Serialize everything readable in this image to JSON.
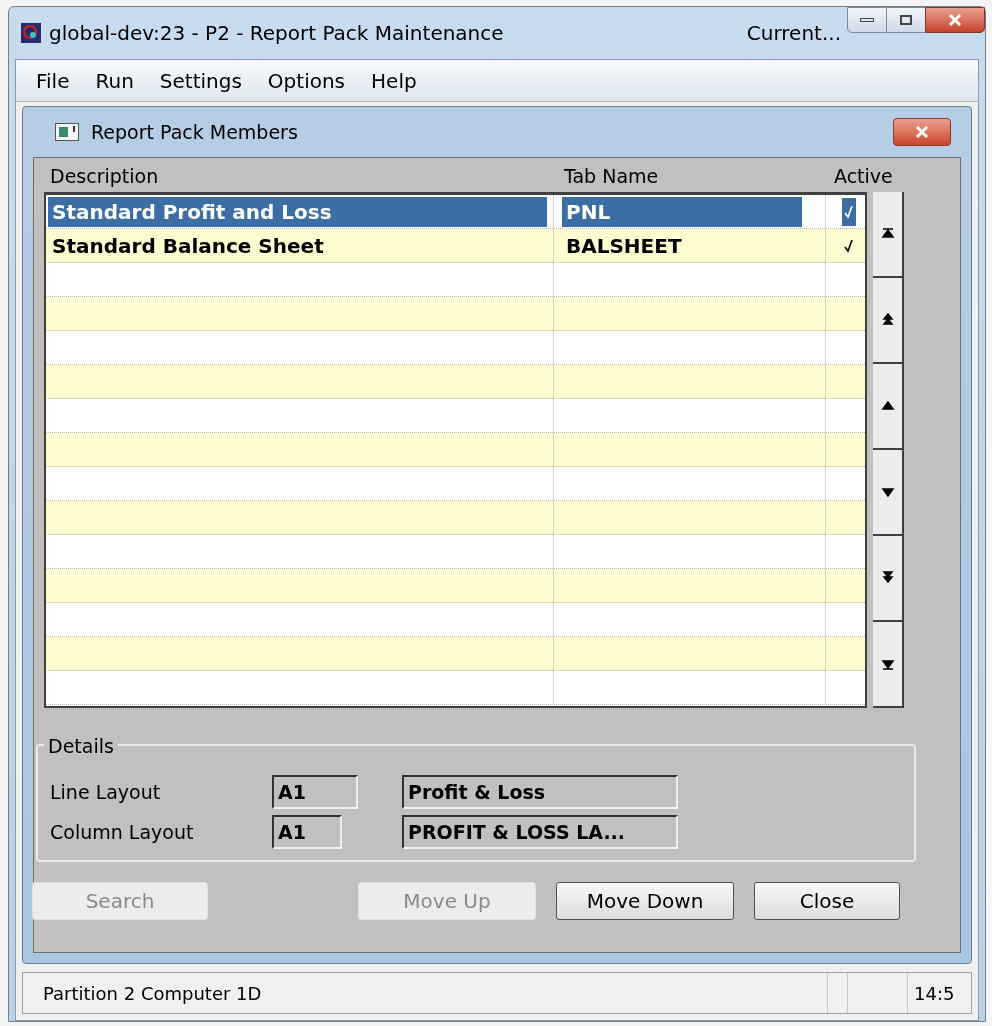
{
  "window": {
    "title": "global-dev:23 - P2 - Report Pack Maintenance",
    "title_right": "Current..."
  },
  "menu": [
    {
      "label": "File"
    },
    {
      "label": "Run"
    },
    {
      "label": "Settings"
    },
    {
      "label": "Options"
    },
    {
      "label": "Help"
    }
  ],
  "dialog": {
    "title": "Report Pack Members"
  },
  "table": {
    "columns": [
      "Description",
      "Tab Name",
      "Active"
    ],
    "rows": [
      {
        "description": "Standard Profit and Loss",
        "tab_name": "PNL",
        "active": true,
        "selected": true
      },
      {
        "description": "Standard Balance Sheet",
        "tab_name": "BALSHEET",
        "active": true,
        "selected": false
      }
    ]
  },
  "details": {
    "title": "Details",
    "fields": [
      {
        "label": "Line Layout",
        "code": "A1",
        "name": "Profit & Loss"
      },
      {
        "label": "Column Layout",
        "code": "A1",
        "name": "PROFIT & LOSS LA..."
      }
    ]
  },
  "buttons": [
    {
      "label": "Search",
      "disabled": true
    },
    {
      "label": "Move Up",
      "disabled": true
    },
    {
      "label": "Move Down",
      "disabled": false
    },
    {
      "label": "Close",
      "disabled": false
    }
  ],
  "status_bar": {
    "text": "Partition 2 Computer 1D",
    "time": "14:5"
  }
}
